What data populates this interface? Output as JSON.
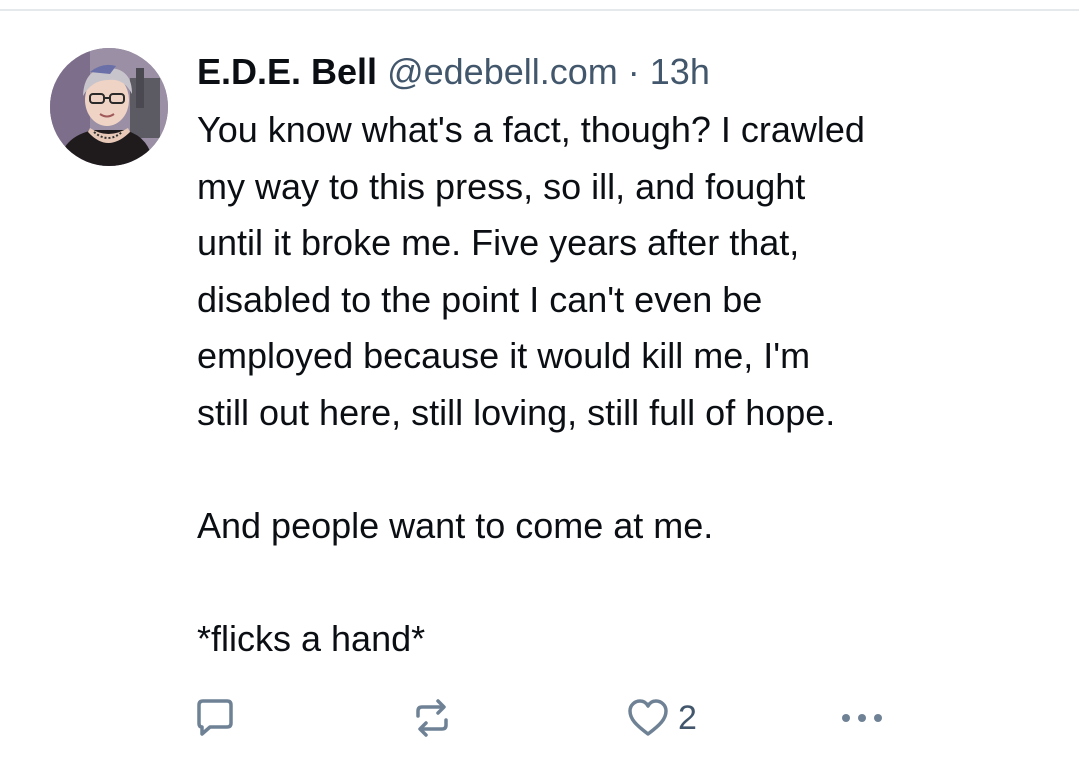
{
  "post": {
    "author": {
      "display_name": "E.D.E. Bell",
      "handle": "@edebell.com",
      "avatar_icon": "avatar-photo"
    },
    "separator": "·",
    "time": "13h",
    "body": {
      "lines_p1": [
        "You know what's a fact, though? I crawled",
        "my way to this press, so ill, and fought",
        "until it broke me. Five years after that,",
        "disabled to the point I can't even be",
        "employed because it would kill me, I'm",
        "still out here, still loving, still full of hope."
      ],
      "p2": "And people want to come at me.",
      "p3": "*flicks a hand*"
    },
    "actions": {
      "reply_icon": "speech-bubble-icon",
      "repost_icon": "repost-icon",
      "like_icon": "heart-icon",
      "like_count": "2",
      "more_icon": "ellipsis-icon"
    },
    "colors": {
      "text": "#0b0f14",
      "muted": "#42576c",
      "icon": "#6f8295"
    }
  }
}
